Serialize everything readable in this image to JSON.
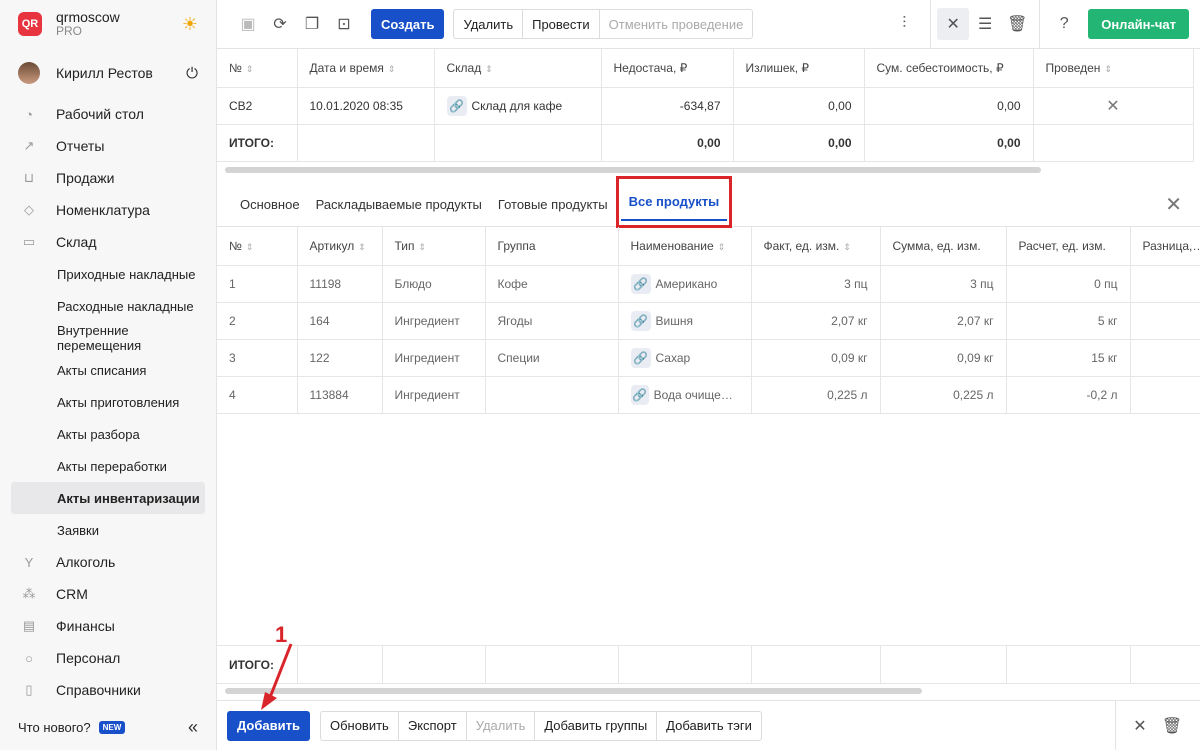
{
  "brand": {
    "name": "qrmoscow",
    "plan": "PRO",
    "logo_text": "QR"
  },
  "user": {
    "name": "Кирилл Рестов"
  },
  "nav": {
    "items": [
      {
        "label": "Рабочий стол",
        "icon": "gauge-icon"
      },
      {
        "label": "Отчеты",
        "icon": "chart-icon"
      },
      {
        "label": "Продажи",
        "icon": "basket-icon"
      },
      {
        "label": "Номенклатура",
        "icon": "tag-icon"
      },
      {
        "label": "Склад",
        "icon": "box-icon"
      }
    ],
    "sub": [
      "Приходные накладные",
      "Расходные накладные",
      "Внутренние перемещения",
      "Акты списания",
      "Акты приготовления",
      "Акты разбора",
      "Акты переработки",
      "Акты инвентаризации",
      "Заявки"
    ],
    "items2": [
      {
        "label": "Алкоголь",
        "icon": "glass-icon"
      },
      {
        "label": "CRM",
        "icon": "crm-icon"
      },
      {
        "label": "Финансы",
        "icon": "wallet-icon"
      },
      {
        "label": "Персонал",
        "icon": "person-icon"
      },
      {
        "label": "Справочники",
        "icon": "book-icon"
      }
    ],
    "whats_new": "Что нового?",
    "new_badge": "NEW"
  },
  "toolbar": {
    "create": "Создать",
    "delete": "Удалить",
    "post": "Провести",
    "unpost": "Отменить проведение",
    "chat": "Онлайн-чат"
  },
  "doc_table": {
    "headers": [
      "№",
      "Дата и время",
      "Склад",
      "Недостача, ₽",
      "Излишек, ₽",
      "Сум. себестоимость, ₽",
      "Проведен"
    ],
    "row": {
      "num": "СВ2",
      "date": "10.01.2020 08:35",
      "warehouse": "Склад для кафе",
      "shortage": "-634,87",
      "surplus": "0,00",
      "cost": "0,00"
    },
    "total": {
      "label": "ИТОГО:",
      "shortage": "0,00",
      "surplus": "0,00",
      "cost": "0,00"
    }
  },
  "tabs": [
    "Основное",
    "Раскладываемые продукты",
    "Готовые продукты",
    "Все продукты"
  ],
  "products": {
    "headers": [
      "№",
      "Артикул",
      "Тип",
      "Группа",
      "Наименование",
      "Факт, ед. изм.",
      "Сумма, ед. изм.",
      "Расчет, ед. изм.",
      "Разница, ед. изм."
    ],
    "rows": [
      {
        "n": "1",
        "sku": "11198",
        "type": "Блюдо",
        "group": "Кофе",
        "name": "Американо",
        "fact": "3 пц",
        "sum": "3 пц",
        "calc": "0 пц"
      },
      {
        "n": "2",
        "sku": "164",
        "type": "Ингредиент",
        "group": "Ягоды",
        "name": "Вишня",
        "fact": "2,07 кг",
        "sum": "2,07 кг",
        "calc": "5 кг"
      },
      {
        "n": "3",
        "sku": "122",
        "type": "Ингредиент",
        "group": "Специи",
        "name": "Сахар",
        "fact": "0,09 кг",
        "sum": "0,09 кг",
        "calc": "15 кг"
      },
      {
        "n": "4",
        "sku": "113884",
        "type": "Ингредиент",
        "group": "",
        "name": "Вода очищенная",
        "fact": "0,225 л",
        "sum": "0,225 л",
        "calc": "-0,2 л"
      }
    ],
    "total_label": "ИТОГО:"
  },
  "bottom": {
    "add": "Добавить",
    "refresh": "Обновить",
    "export": "Экспорт",
    "delete": "Удалить",
    "add_groups": "Добавить группы",
    "add_tags": "Добавить тэги"
  },
  "annotation": "1"
}
